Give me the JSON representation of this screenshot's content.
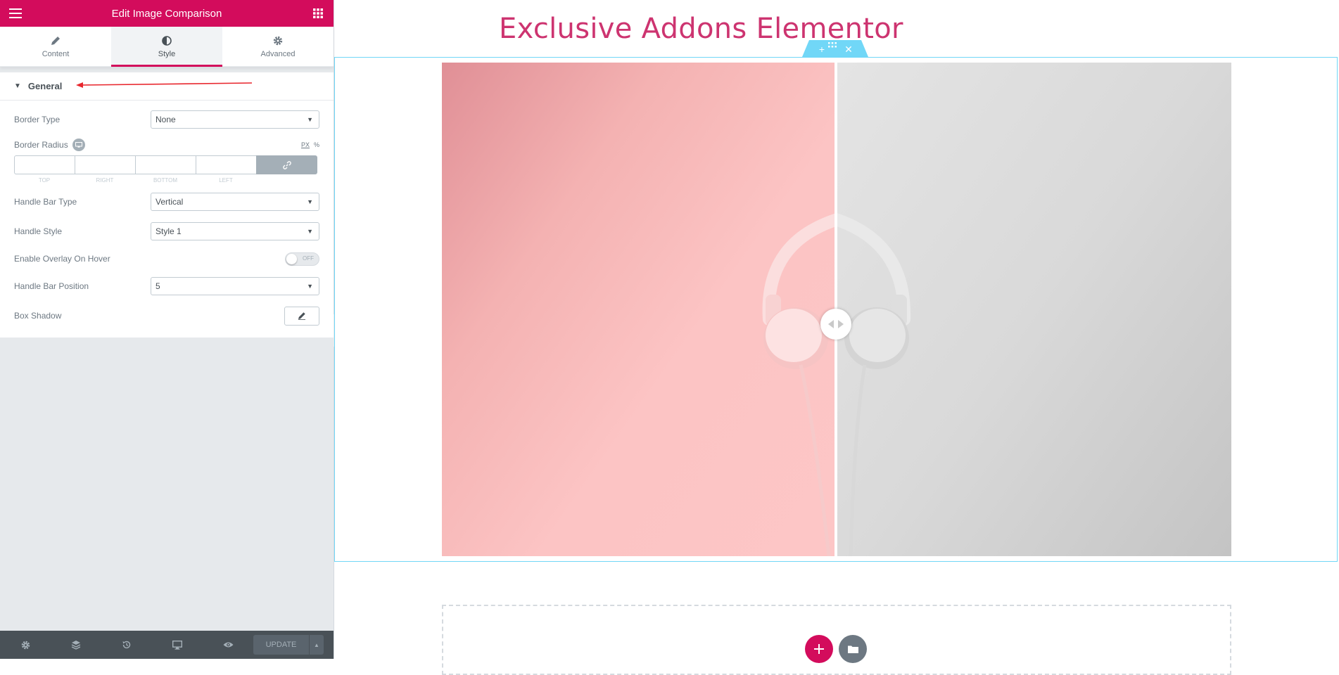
{
  "panel": {
    "title": "Edit Image Comparison",
    "tabs": [
      {
        "label": "Content",
        "icon": "pencil-icon"
      },
      {
        "label": "Style",
        "icon": "half-circle-icon",
        "active": true
      },
      {
        "label": "Advanced",
        "icon": "gear-icon"
      }
    ],
    "section": {
      "label": "General",
      "expanded": true
    },
    "controls": {
      "border_type": {
        "label": "Border Type",
        "value": "None"
      },
      "border_radius": {
        "label": "Border Radius",
        "unit_px": "PX",
        "unit_pct": "%",
        "dims": [
          "TOP",
          "RIGHT",
          "BOTTOM",
          "LEFT"
        ]
      },
      "handle_bar_type": {
        "label": "Handle Bar Type",
        "value": "Vertical"
      },
      "handle_style": {
        "label": "Handle Style",
        "value": "Style 1"
      },
      "overlay_on_hover": {
        "label": "Enable Overlay On Hover",
        "state": "OFF"
      },
      "handle_bar_position": {
        "label": "Handle Bar Position",
        "value": "5"
      },
      "box_shadow": {
        "label": "Box Shadow"
      }
    },
    "footer": {
      "update_label": "UPDATE"
    }
  },
  "canvas": {
    "heading": "Exclusive Addons Elementor",
    "comparison_handle_position": 0.5
  },
  "colors": {
    "brand": "#d30c5c",
    "heading": "#cd3470",
    "selection": "#71d7f7"
  }
}
